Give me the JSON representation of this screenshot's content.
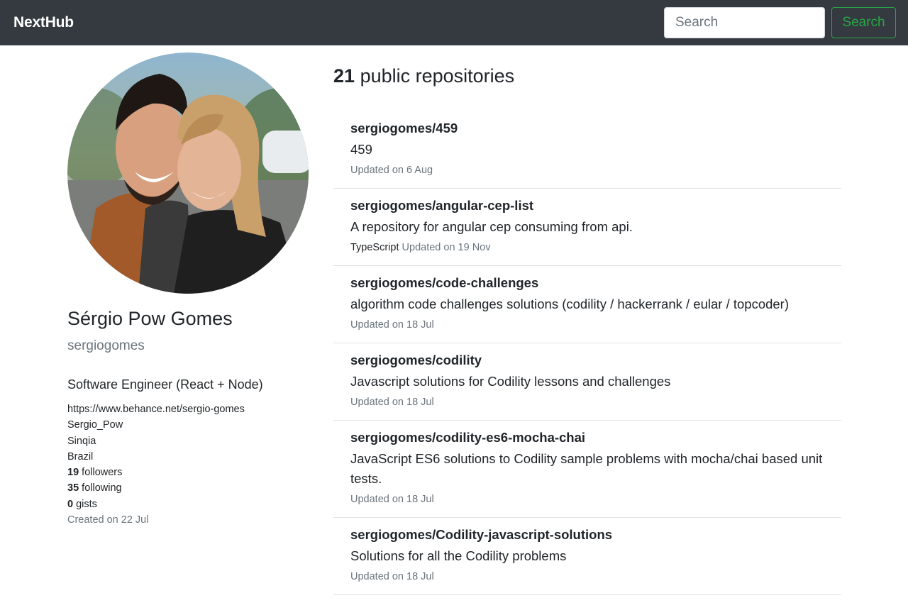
{
  "navbar": {
    "brand": "NextHub",
    "search_placeholder": "Search",
    "search_button": "Search"
  },
  "profile": {
    "name": "Sérgio Pow Gomes",
    "login": "sergiogomes",
    "bio": "Software Engineer (React + Node)",
    "blog": "https://www.behance.net/sergio-gomes",
    "twitter": "Sergio_Pow",
    "company": "Sinqia",
    "location": "Brazil",
    "followers": "19",
    "followers_label": "followers",
    "following": "35",
    "following_label": "following",
    "gists": "0",
    "gists_label": "gists",
    "created": "Created on 22 Jul"
  },
  "repos": {
    "count": "21",
    "title_suffix": "public repositories",
    "items": [
      {
        "name": "sergiogomes/459",
        "description": "459",
        "language": "",
        "updated": "Updated on 6 Aug"
      },
      {
        "name": "sergiogomes/angular-cep-list",
        "description": "A repository for angular cep consuming from api.",
        "language": "TypeScript",
        "updated": "Updated on 19 Nov"
      },
      {
        "name": "sergiogomes/code-challenges",
        "description": "algorithm code challenges solutions (codility / hackerrank / eular / topcoder)",
        "language": "",
        "updated": "Updated on 18 Jul"
      },
      {
        "name": "sergiogomes/codility",
        "description": "Javascript solutions for Codility lessons and challenges",
        "language": "",
        "updated": "Updated on 18 Jul"
      },
      {
        "name": "sergiogomes/codility-es6-mocha-chai",
        "description": "JavaScript ES6 solutions to Codility sample problems with mocha/chai based unit tests.",
        "language": "",
        "updated": "Updated on 18 Jul"
      },
      {
        "name": "sergiogomes/Codility-javascript-solutions",
        "description": "Solutions for all the Codility problems",
        "language": "",
        "updated": "Updated on 18 Jul"
      }
    ]
  }
}
